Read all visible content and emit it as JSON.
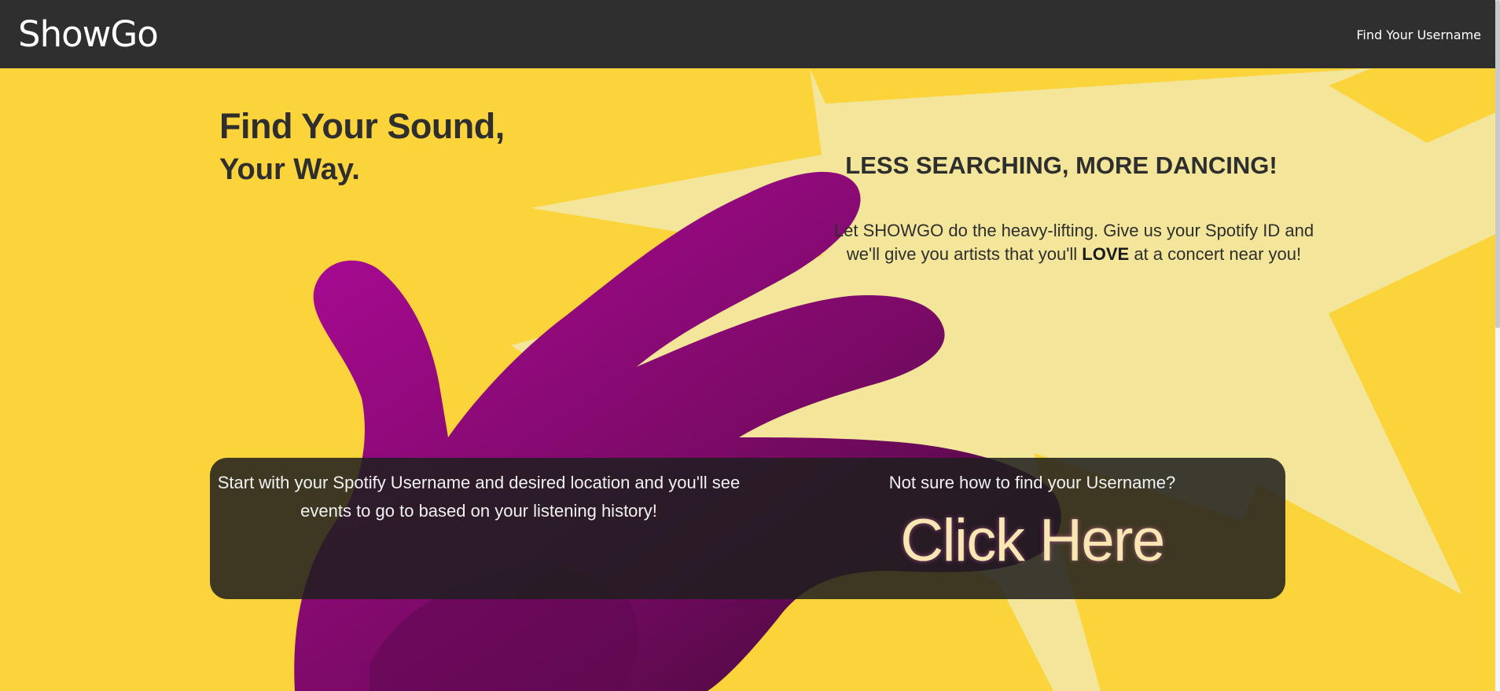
{
  "navbar": {
    "brand": "ShowGo",
    "link": "Find Your Username"
  },
  "hero": {
    "title": "Find Your Sound,",
    "subtitle": "Your Way.",
    "tagline": "LESS SEARCHING, MORE DANCING!",
    "description": {
      "before": "Let SHOWGO do the heavy-lifting. Give us your Spotify ID and we'll give you artists that you'll ",
      "emphasis": "LOVE",
      "after": " at a concert near you!"
    }
  },
  "cta": {
    "instructions": "Start with your Spotify Username and desired location and you'll see events to go to based on your listening history!",
    "question": "Not sure how to find your Username?",
    "button": "Click Here"
  },
  "colors": {
    "navbar": "#2f2f2f",
    "hero_background": "#fbd33b",
    "starburst": "#f3e59a",
    "hand": "#8e0b7a",
    "text_dark": "#2e2e2e",
    "panel": "#1e1e1e",
    "button_text": "#f8e7b3"
  },
  "images": {
    "background_illustration": "magenta-hand-starburst"
  }
}
